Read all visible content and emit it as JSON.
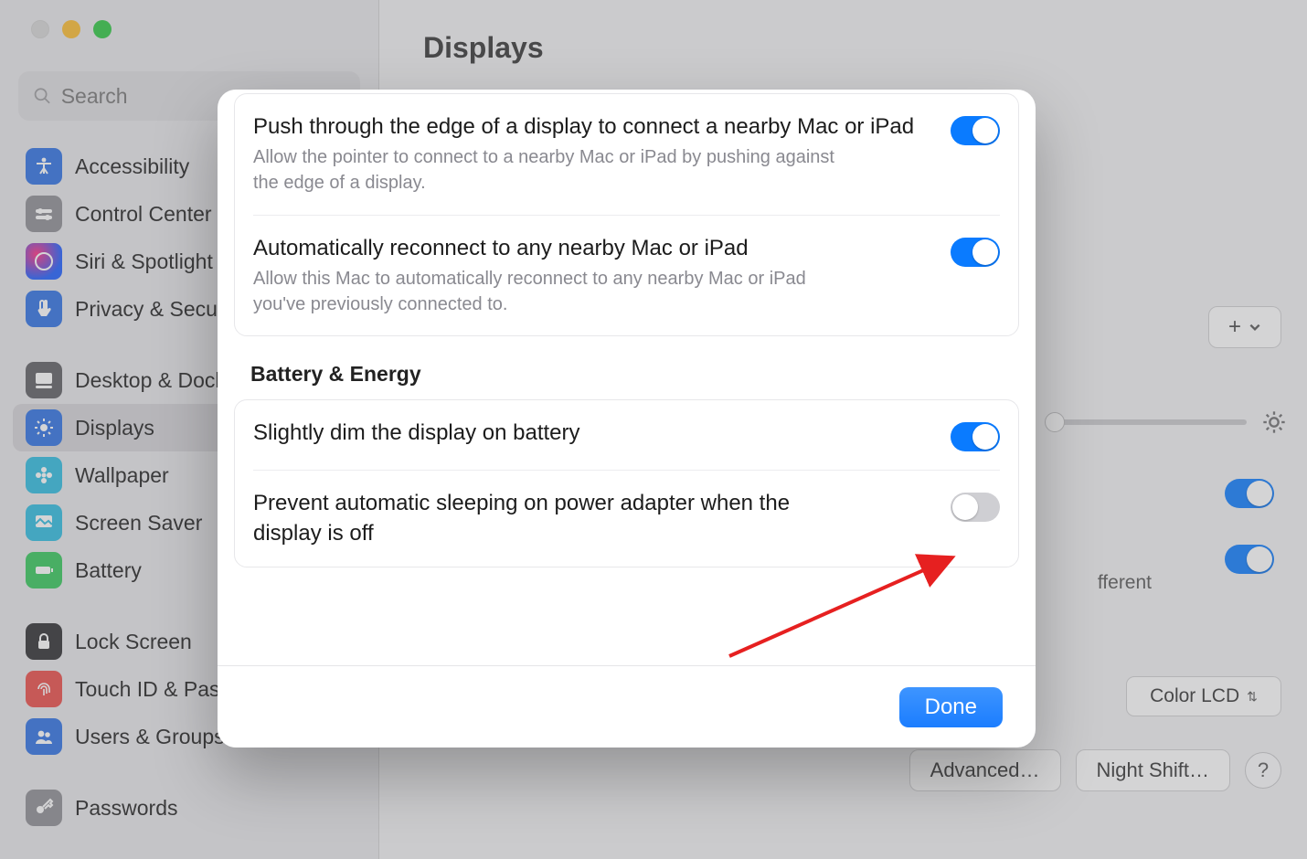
{
  "window": {
    "title": "Displays",
    "search_placeholder": "Search"
  },
  "sidebar": {
    "items": [
      {
        "label": "Accessibility",
        "icon": "accessibility",
        "color": "ic-blue"
      },
      {
        "label": "Control Center",
        "icon": "sliders",
        "color": "ic-gray"
      },
      {
        "label": "Siri & Spotlight",
        "icon": "siri",
        "color": "siri-bg"
      },
      {
        "label": "Privacy & Security",
        "icon": "hand",
        "color": "ic-blue"
      },
      {
        "spacer": true
      },
      {
        "label": "Desktop & Dock",
        "icon": "desktop",
        "color": "ic-darkgray"
      },
      {
        "label": "Displays",
        "icon": "brightness",
        "color": "ic-blue",
        "selected": true
      },
      {
        "label": "Wallpaper",
        "icon": "flower",
        "color": "ic-teal"
      },
      {
        "label": "Screen Saver",
        "icon": "screensaver",
        "color": "ic-teal"
      },
      {
        "label": "Battery",
        "icon": "battery",
        "color": "ic-green"
      },
      {
        "spacer": true
      },
      {
        "label": "Lock Screen",
        "icon": "lock",
        "color": "ic-black"
      },
      {
        "label": "Touch ID & Password",
        "icon": "fingerprint",
        "color": "ic-red"
      },
      {
        "label": "Users & Groups",
        "icon": "users",
        "color": "ic-blue"
      },
      {
        "spacer": true
      },
      {
        "label": "Passwords",
        "icon": "key",
        "color": "ic-gray"
      }
    ]
  },
  "background_panel": {
    "different_label_fragment": "fferent",
    "color_profile": "Color LCD",
    "advanced_button": "Advanced…",
    "night_shift_button": "Night Shift…",
    "toggles": [
      true,
      true
    ],
    "add_plus": "+"
  },
  "modal": {
    "groups": [
      {
        "rows": [
          {
            "title": "Push through the edge of a display to connect a nearby Mac or iPad",
            "desc": "Allow the pointer to connect to a nearby Mac or iPad by pushing against the edge of a display.",
            "on": true
          },
          {
            "title": "Automatically reconnect to any nearby Mac or iPad",
            "desc": "Allow this Mac to automatically reconnect to any nearby Mac or iPad you've previously connected to.",
            "on": true
          }
        ]
      }
    ],
    "section_label": "Battery & Energy",
    "energy_group": {
      "rows": [
        {
          "title": "Slightly dim the display on battery",
          "desc": "",
          "on": true
        },
        {
          "title": "Prevent automatic sleeping on power adapter when the display is off",
          "desc": "",
          "on": false
        }
      ]
    },
    "done_label": "Done"
  }
}
